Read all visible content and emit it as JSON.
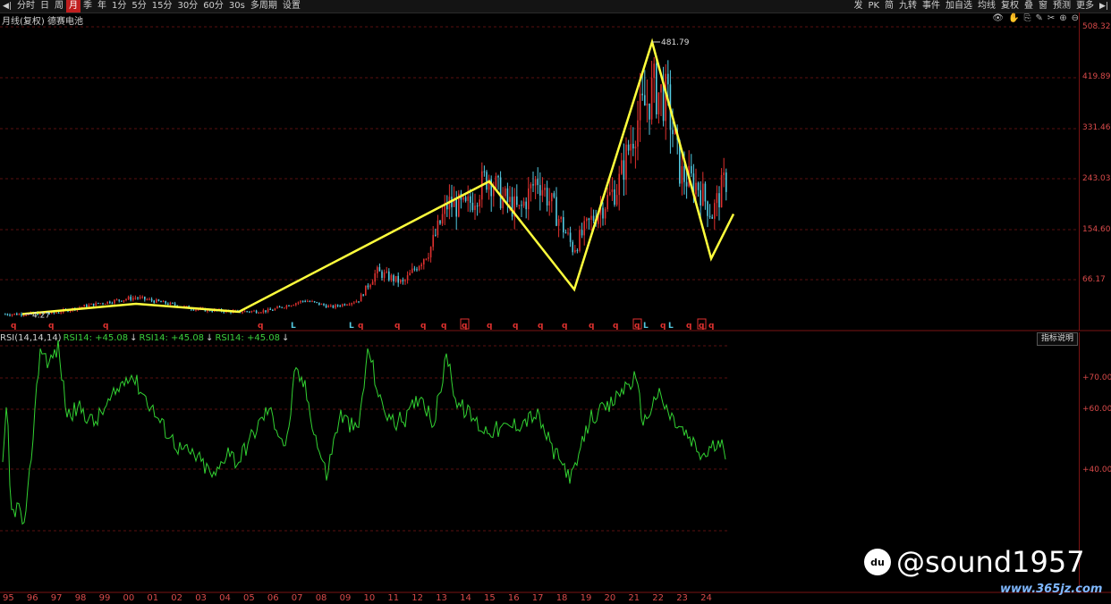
{
  "toolbar": {
    "left_items": [
      "分时",
      "日",
      "周",
      "月",
      "季",
      "年",
      "1分",
      "5分",
      "15分",
      "30分",
      "60分",
      "30s",
      "多周期",
      "设置"
    ],
    "active": "月",
    "right_items": [
      "发",
      "PK",
      "简",
      "九转",
      "事件",
      "加自选",
      "均线",
      "复权",
      "叠",
      "窗",
      "预测",
      "更多"
    ]
  },
  "title": "月线(复权)  德赛电池",
  "price_axis": [
    "508.32",
    "419.89",
    "331.46",
    "243.03",
    "154.60",
    "66.17"
  ],
  "price_markers": {
    "high": "481.79",
    "low": "4.27"
  },
  "signals": [
    "q",
    "q",
    "q",
    "q",
    "L",
    "L",
    "q",
    "q",
    "q",
    "q",
    "q",
    "q",
    "q",
    "q",
    "q",
    "q",
    "q",
    "q",
    "L",
    "q",
    "L",
    "q",
    "q",
    "q"
  ],
  "rsi": {
    "title": "RSI(14,14,14)",
    "values": [
      "RSI14: +45.08",
      "RSI14: +45.08",
      "RSI14: +45.08"
    ],
    "arrows": [
      "↓",
      "↓",
      "↓"
    ],
    "axis": [
      "+70.00",
      "+60.00",
      "+40.00"
    ],
    "button": "指标说明"
  },
  "years": [
    "95",
    "96",
    "97",
    "98",
    "99",
    "00",
    "01",
    "02",
    "03",
    "04",
    "05",
    "06",
    "07",
    "08",
    "09",
    "10",
    "11",
    "12",
    "13",
    "14",
    "15",
    "16",
    "17",
    "18",
    "19",
    "20",
    "21",
    "22",
    "23",
    "24"
  ],
  "watermark": "@sound1957",
  "site": "www.365jz.com",
  "colors": {
    "up": "#e0312f",
    "down": "#53c9e0",
    "zigzag": "#ffff3c",
    "rsi": "#32d232",
    "axis": "#d94a4a"
  }
}
